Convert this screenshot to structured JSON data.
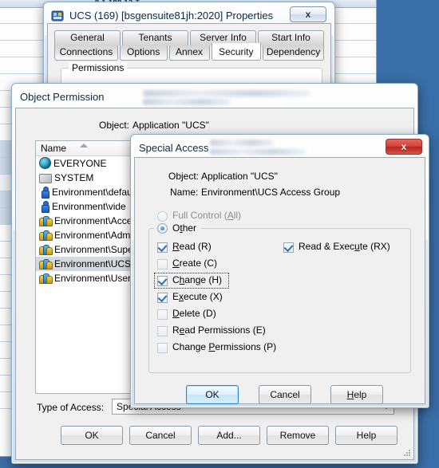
{
  "desktop": {
    "background_color": "#3a6ea8"
  },
  "background_window": {
    "title_fragment": "8.1.188.12            T",
    "rows": 12
  },
  "ucs_properties": {
    "title": "UCS (169) [bsgensuite81jh:2020] Properties",
    "icon": "app-properties-icon",
    "close_label": "x",
    "tabs_row1": [
      "General",
      "Tenants",
      "Server Info",
      "Start Info"
    ],
    "tabs_row2": [
      "Connections",
      "Options",
      "Annex",
      "Security",
      "Dependency"
    ],
    "active_tab": "Security",
    "group_label": "Permissions"
  },
  "object_permission": {
    "title": "Object Permission",
    "object_label": "Object:",
    "object_value": "Application \"UCS\"",
    "list_header": "Name",
    "list_items": [
      {
        "icon": "globe-icon",
        "label": "EVERYONE",
        "selected": false
      },
      {
        "icon": "chip-icon",
        "label": "SYSTEM",
        "selected": false
      },
      {
        "icon": "user-icon",
        "label": "Environment\\default",
        "selected": false
      },
      {
        "icon": "user-icon",
        "label": "Environment\\vide",
        "selected": false
      },
      {
        "icon": "group-icon",
        "label": "Environment\\Access",
        "selected": false
      },
      {
        "icon": "group-icon",
        "label": "Environment\\Administ",
        "selected": false
      },
      {
        "icon": "group-icon",
        "label": "Environment\\Super A",
        "selected": false
      },
      {
        "icon": "group-icon",
        "label": "Environment\\UCS Ac",
        "selected": true
      },
      {
        "icon": "group-icon",
        "label": "Environment\\Users",
        "selected": false
      }
    ],
    "type_of_access_label": "Type of Access:",
    "type_of_access_value": "Special Access",
    "buttons": [
      "OK",
      "Cancel",
      "Add...",
      "Remove",
      "Help"
    ]
  },
  "special_access": {
    "title": "Special Access",
    "close_label": "x",
    "object_label": "Object:",
    "object_value": "Application \"UCS\"",
    "name_label": "Name:",
    "name_value": "Environment\\UCS Access Group",
    "radios": [
      {
        "label": "Full Control (All)",
        "accesskey": "A",
        "checked": false,
        "disabled": true
      },
      {
        "label": "Other",
        "accesskey": "t",
        "checked": true,
        "disabled": false
      }
    ],
    "checkboxes_left": [
      {
        "label": "Read (R)",
        "checked": true,
        "focused": false
      },
      {
        "label": "Create (C)",
        "checked": false,
        "focused": false
      },
      {
        "label": "Change (H)",
        "checked": true,
        "focused": true
      },
      {
        "label": "Execute (X)",
        "checked": true,
        "focused": false
      },
      {
        "label": "Delete (D)",
        "checked": false,
        "focused": false
      },
      {
        "label": "Read Permissions (E)",
        "checked": false,
        "focused": false
      },
      {
        "label": "Change Permissions (P)",
        "checked": false,
        "focused": false
      }
    ],
    "checkboxes_right": [
      {
        "label": "Read & Execute (RX)",
        "checked": true,
        "focused": false
      }
    ],
    "buttons": [
      "OK",
      "Cancel",
      "Help"
    ],
    "default_button": "OK"
  }
}
